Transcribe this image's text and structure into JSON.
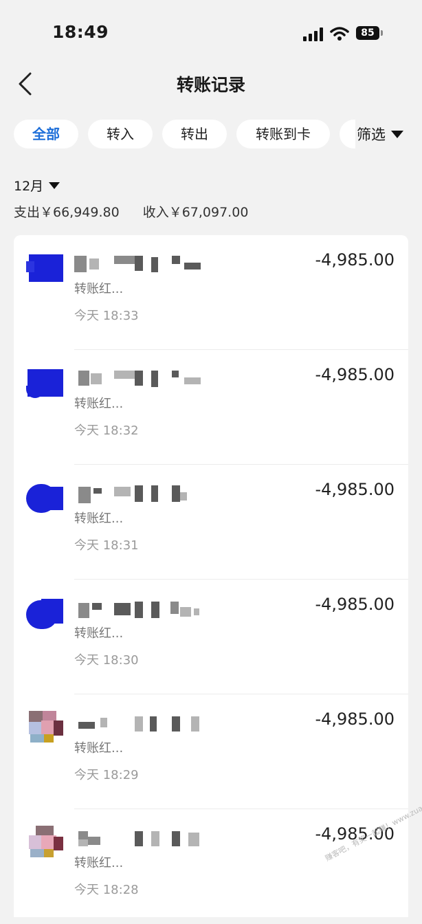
{
  "status_bar": {
    "time": "18:49",
    "battery": "85"
  },
  "header": {
    "title": "转账记录"
  },
  "filters": {
    "tabs": [
      {
        "label": "全部",
        "active": true
      },
      {
        "label": "转入",
        "active": false
      },
      {
        "label": "转出",
        "active": false
      },
      {
        "label": "转账到卡",
        "active": false
      }
    ],
    "filter_label": "筛选"
  },
  "summary": {
    "month": "12月",
    "expense": "支出￥66,949.80",
    "income": "收入￥67,097.00"
  },
  "records": [
    {
      "memo": "转账红...",
      "time": "今天 18:33",
      "amount": "-4,985.00"
    },
    {
      "memo": "转账红...",
      "time": "今天 18:32",
      "amount": "-4,985.00"
    },
    {
      "memo": "转账红...",
      "time": "今天 18:31",
      "amount": "-4,985.00"
    },
    {
      "memo": "转账红...",
      "time": "今天 18:30",
      "amount": "-4,985.00"
    },
    {
      "memo": "转账红...",
      "time": "今天 18:29",
      "amount": "-4,985.00"
    },
    {
      "memo": "转账红...",
      "time": "今天 18:28",
      "amount": "-4,985.00"
    }
  ],
  "colors": {
    "accent": "#1e6fd9",
    "background": "#f2f2f2",
    "card": "#ffffff"
  },
  "watermark": "赚客吧，有奖一起赚！www.zuanke8.com"
}
